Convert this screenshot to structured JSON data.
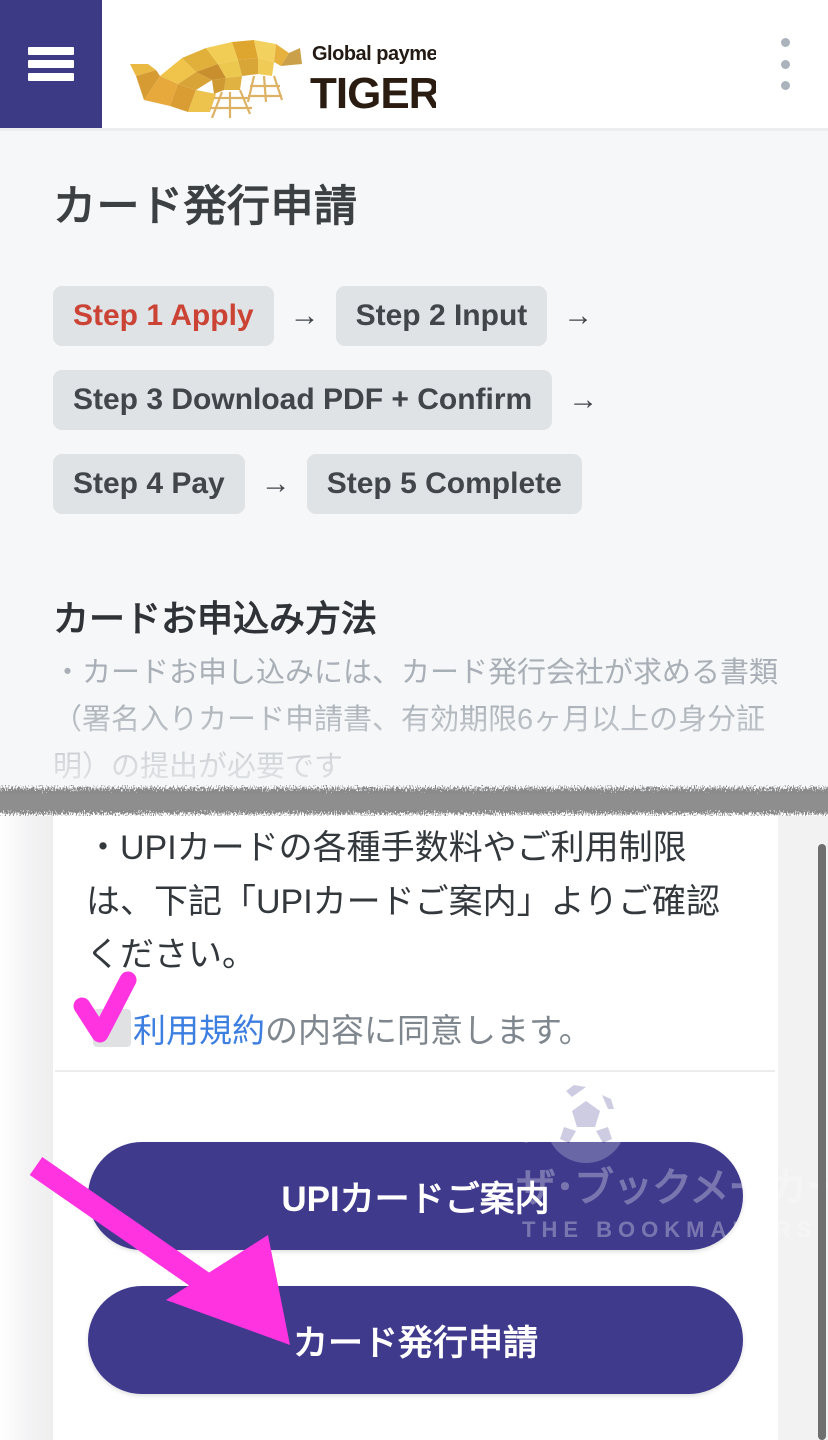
{
  "colors": {
    "brand_purple": "#3d3a85",
    "button_purple": "#3f3a8c",
    "step_active_red": "#cb4335",
    "chip_grey": "#dfe3e6",
    "link_blue": "#3c7fe0",
    "annotation_magenta": "#ff33e0",
    "page_bg": "#f6f7f8"
  },
  "header": {
    "menu_icon": "hamburger-icon",
    "overflow_icon": "kebab-menu-icon",
    "logo": {
      "tagline": "Global payment solution",
      "wordmark": "TIGER PAY",
      "mark_icon": "tiger-logo-icon"
    }
  },
  "page": {
    "title": "カード発行申請"
  },
  "steps": {
    "arrow_glyph": "→",
    "rows": [
      {
        "items": [
          {
            "label": "Step 1 Apply",
            "active": true
          },
          {
            "label": "Step 2 Input",
            "active": false
          }
        ],
        "trailing_arrow": true
      },
      {
        "items": [
          {
            "label": "Step 3 Download PDF + Confirm",
            "active": false
          }
        ],
        "trailing_arrow": true
      },
      {
        "items": [
          {
            "label": "Step 4 Pay",
            "active": false
          },
          {
            "label": "Step 5 Complete",
            "active": false
          }
        ],
        "trailing_arrow": false
      }
    ]
  },
  "section": {
    "heading": "カードお申込み方法",
    "paragraph": "・カードお申し込みには、カード発行会社が求める書類（署名入りカード申請書、有効期限6ヶ月以上の身分証明）の提出が必要です"
  },
  "bottom": {
    "paragraph": "・UPIカードの各種手数料やご利用制限は、下記「UPIカードご案内」よりご確認ください。",
    "agreement": {
      "checkbox_name": "terms-checkbox",
      "link_text": "利用規約",
      "rest_text": "の内容に同意します。"
    },
    "buttons": [
      {
        "label": "UPIカードご案内",
        "name": "upi-card-guide-button"
      },
      {
        "label": "カード発行申請",
        "name": "card-issue-apply-button"
      }
    ],
    "watermark": {
      "text_jp": "ザ・ブックメーカーズ",
      "text_en": "THE BOOKMAKERS",
      "icon": "flaming-soccer-ball-icon"
    }
  },
  "annotations": {
    "check_mark": "magenta-check-annotation",
    "arrow": "magenta-arrow-annotation"
  }
}
